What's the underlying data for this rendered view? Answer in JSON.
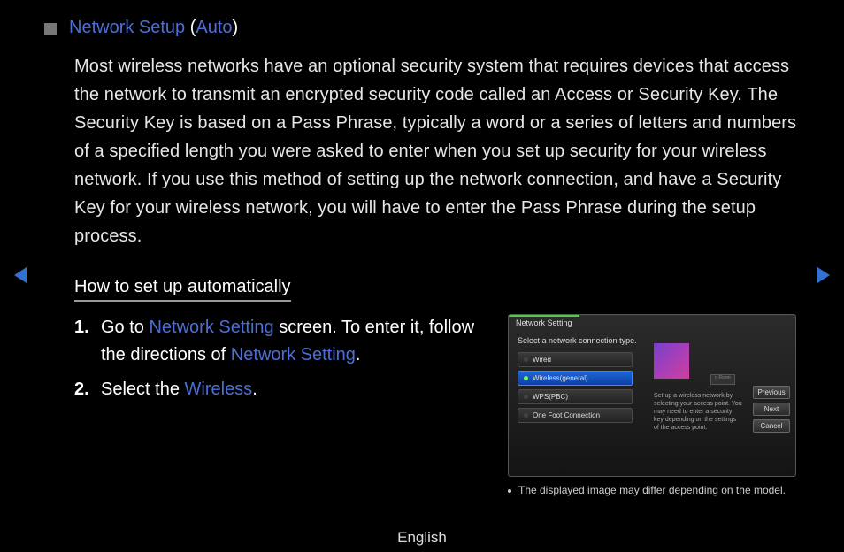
{
  "heading": {
    "title": "Network Setup",
    "paren_open": " (",
    "mode": "Auto",
    "paren_close": ")"
  },
  "body_para": "Most wireless networks have an optional security system that requires devices that access the network to transmit an encrypted security code called an Access or Security Key. The Security Key is based on a Pass Phrase, typically a word or a series of letters and numbers of a specified length you were asked to enter when you set up security for your wireless network. If you use this method of setting up the network connection, and have a Security Key for your wireless network, you will have to enter the Pass Phrase during the setup process.",
  "sub_heading": "How to set up automatically",
  "steps": {
    "s1": {
      "num": "1.",
      "pre": "Go to ",
      "link1": "Network Setting",
      "mid": " screen. To enter it, follow the directions of ",
      "link2": "Network Setting",
      "post": "."
    },
    "s2": {
      "num": "2.",
      "pre": "Select the ",
      "link": "Wireless",
      "post": "."
    }
  },
  "tv": {
    "tab": "Network Setting",
    "prompt": "Select a network connection type.",
    "options": {
      "wired": "Wired",
      "wireless": "Wireless(general)",
      "wps": "WPS(PBC)",
      "onefoot": "One Foot Connection"
    },
    "desc": "Set up a wireless network by selecting your access point. You may need to enter a security key depending on the settings of the access point.",
    "buttons": {
      "prev": "Previous",
      "next": "Next",
      "cancel": "Cancel"
    },
    "router_label": "n Room"
  },
  "caption": "The displayed image may differ depending on the model.",
  "footer": "English"
}
